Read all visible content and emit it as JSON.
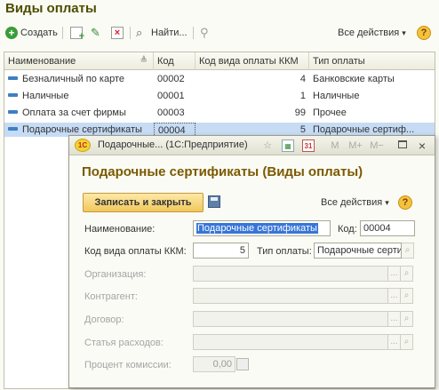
{
  "main": {
    "title": "Виды оплаты"
  },
  "toolbar": {
    "create_label": "Создать",
    "find_label": "Найти...",
    "all_actions_label": "Все действия",
    "all_actions_arrow": "▾",
    "help_glyph": "?",
    "icons": [
      "create-icon",
      "copy-icon",
      "edit-icon",
      "delete-icon",
      "find-icon",
      "filter-icon",
      "help-icon"
    ]
  },
  "grid": {
    "columns": [
      "Наименование",
      "Код",
      "Код вида оплаты ККМ",
      "Тип оплаты"
    ],
    "rows": [
      {
        "name": "Безналичный по карте",
        "code": "00002",
        "kkm": "4",
        "type": "Банковские карты",
        "selected": false
      },
      {
        "name": "Наличные",
        "code": "00001",
        "kkm": "1",
        "type": "Наличные",
        "selected": false
      },
      {
        "name": "Оплата за счет фирмы",
        "code": "00003",
        "kkm": "99",
        "type": "Прочее",
        "selected": false
      },
      {
        "name": "Подарочные сертификаты",
        "code": "00004",
        "kkm": "5",
        "type": "Подарочные сертиф...",
        "selected": true
      }
    ]
  },
  "dialog": {
    "window_title": "Подарочные... (1С:Предприятие)",
    "logo_text": "1С",
    "titlebar_icons": [
      "star-icon",
      "report-icon",
      "calendar-icon",
      "m-memory-icon",
      "m-plus-icon",
      "m-minus-icon",
      "restore-icon",
      "close-icon"
    ],
    "m_label": "M",
    "m_plus_label": "M+",
    "m_minus_label": "M−",
    "calendar_label": "31",
    "heading": "Подарочные сертификаты (Виды оплаты)",
    "save_close_label": "Записать и закрыть",
    "all_actions_label": "Все действия",
    "all_actions_arrow": "▾",
    "help_glyph": "?",
    "fields": {
      "name_label": "Наименование:",
      "name_value": "Подарочные сертификаты",
      "code_label": "Код:",
      "code_value": "00004",
      "kkm_label": "Код вида оплаты ККМ:",
      "kkm_value": "5",
      "payment_type_label": "Тип оплаты:",
      "payment_type_value": "Подарочные серти",
      "org_label": "Организация:",
      "counterparty_label": "Контрагент:",
      "contract_label": "Договор:",
      "expense_label": "Статья расходов:",
      "commission_label": "Процент комиссии:",
      "commission_value": "0,00",
      "dots_glyph": "...",
      "search_glyph": "🔍"
    }
  },
  "colors": {
    "title": "#4d4d00",
    "dialog_heading": "#7a5a00",
    "selected_row": "#c6dbf4",
    "save_button": "#f1c75c"
  }
}
